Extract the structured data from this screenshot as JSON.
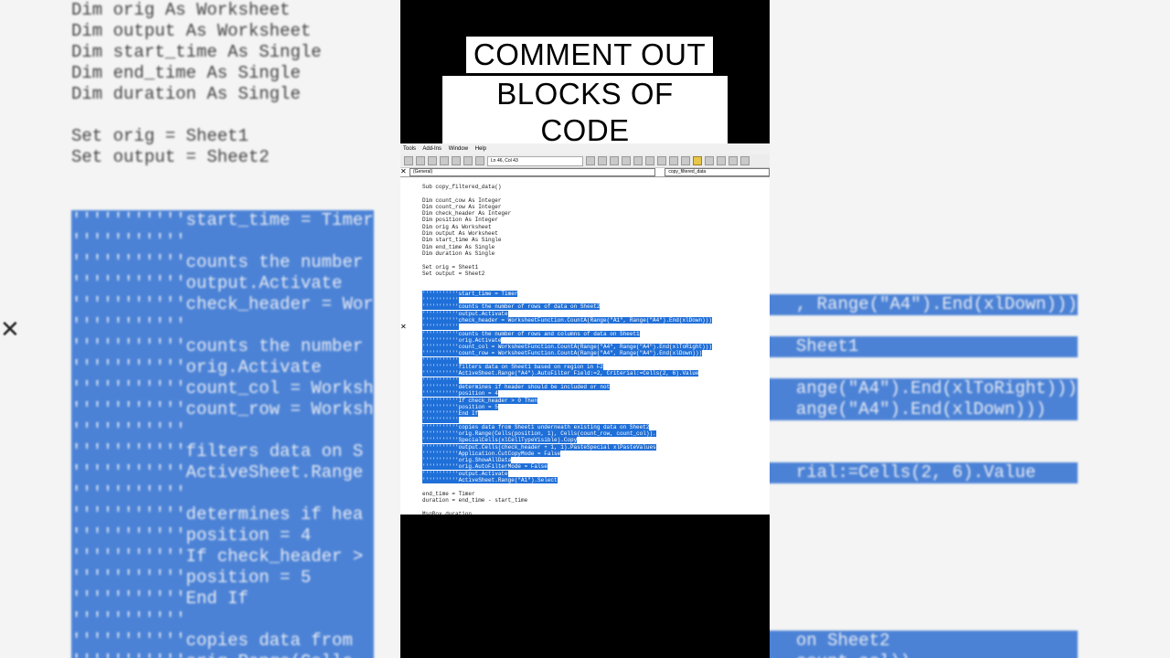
{
  "title": {
    "line1": "COMMENT OUT",
    "line2": "BLOCKS OF CODE"
  },
  "editor": {
    "menu": [
      "Tools",
      "Add-Ins",
      "Window",
      "Help"
    ],
    "position": "Ln 46, Col 43",
    "object_combo": "(General)",
    "proc_combo": "copy_filtered_data",
    "code_lines": [
      {
        "text": "Sub copy_filtered_data()",
        "sel": false
      },
      {
        "text": "",
        "sel": false
      },
      {
        "text": "Dim count_cow As Integer",
        "sel": false
      },
      {
        "text": "Dim count_row As Integer",
        "sel": false
      },
      {
        "text": "Dim check_header As Integer",
        "sel": false
      },
      {
        "text": "Dim position As Integer",
        "sel": false
      },
      {
        "text": "Dim orig As Worksheet",
        "sel": false
      },
      {
        "text": "Dim output As Worksheet",
        "sel": false
      },
      {
        "text": "Dim start_time As Single",
        "sel": false
      },
      {
        "text": "Dim end_time As Single",
        "sel": false
      },
      {
        "text": "Dim duration As Single",
        "sel": false
      },
      {
        "text": "",
        "sel": false
      },
      {
        "text": "Set orig = Sheet1",
        "sel": false
      },
      {
        "text": "Set output = Sheet2",
        "sel": false
      },
      {
        "text": "",
        "sel": false
      },
      {
        "text": "",
        "sel": false
      },
      {
        "text": "'''''''''''start_time = Timer",
        "sel": true
      },
      {
        "text": "'''''''''''",
        "sel": true
      },
      {
        "text": "'''''''''''counts the number of rows of data on Sheet2",
        "sel": true
      },
      {
        "text": "'''''''''''output.Activate",
        "sel": true
      },
      {
        "text": "'''''''''''check_header = WorksheetFunction.CountA(Range(\"A1\", Range(\"A4\").End(xlDown)))",
        "sel": true
      },
      {
        "text": "'''''''''''",
        "sel": true
      },
      {
        "text": "'''''''''''counts the number of rows and columns of data on Sheet1",
        "sel": true
      },
      {
        "text": "'''''''''''orig.Activate",
        "sel": true
      },
      {
        "text": "'''''''''''count_col = WorksheetFunction.CountA(Range(\"A4\", Range(\"A4\").End(xlToRight)))",
        "sel": true
      },
      {
        "text": "'''''''''''count_row = WorksheetFunction.CountA(Range(\"A4\", Range(\"A4\").End(xlDown)))",
        "sel": true
      },
      {
        "text": "'''''''''''",
        "sel": true
      },
      {
        "text": "'''''''''''filters data on Sheet1 based on region in F2",
        "sel": true
      },
      {
        "text": "'''''''''''ActiveSheet.Range(\"A4\").AutoFilter Field:=2, Criterial:=Cells(2, 6).Value",
        "sel": true
      },
      {
        "text": "'''''''''''",
        "sel": true
      },
      {
        "text": "'''''''''''determines if header should be included or not",
        "sel": true
      },
      {
        "text": "'''''''''''position = 4",
        "sel": true
      },
      {
        "text": "'''''''''''If check_header > 0 Then",
        "sel": true
      },
      {
        "text": "'''''''''''position = 5",
        "sel": true
      },
      {
        "text": "'''''''''''End If",
        "sel": true
      },
      {
        "text": "'''''''''''",
        "sel": true
      },
      {
        "text": "'''''''''''copies data from Sheet1 underneath existing data on Sheet2",
        "sel": true
      },
      {
        "text": "'''''''''''orig.Range(Cells(position, 1), Cells(count_row, count_col)).",
        "sel": true
      },
      {
        "text": "'''''''''''SpecialCells(xlCellTypeVisible).Copy",
        "sel": true
      },
      {
        "text": "'''''''''''output.Cells(check_header + 1, 1).PasteSpecial xlPasteValues",
        "sel": true
      },
      {
        "text": "'''''''''''Application.CutCopyMode = False",
        "sel": true
      },
      {
        "text": "'''''''''''orig.ShowAllData",
        "sel": true
      },
      {
        "text": "'''''''''''orig.AutoFilterMode = False",
        "sel": true
      },
      {
        "text": "'''''''''''output.Activate",
        "sel": true
      },
      {
        "text": "'''''''''''ActiveSheet.Range(\"A1\").Select",
        "sel": true
      },
      {
        "text": "",
        "sel": false
      },
      {
        "text": "end_time = Timer",
        "sel": false
      },
      {
        "text": "duration = end_time - start_time",
        "sel": false
      },
      {
        "text": "",
        "sel": false
      },
      {
        "text": "MsgBox duration",
        "sel": false
      }
    ]
  },
  "background": {
    "left_lines": [
      {
        "text": "Dim orig As Worksheet",
        "sel": false
      },
      {
        "text": "Dim output As Worksheet",
        "sel": false
      },
      {
        "text": "Dim start_time As Single",
        "sel": false
      },
      {
        "text": "Dim end_time As Single",
        "sel": false
      },
      {
        "text": "Dim duration As Single",
        "sel": false
      },
      {
        "text": "",
        "sel": false
      },
      {
        "text": "Set orig = Sheet1",
        "sel": false
      },
      {
        "text": "Set output = Sheet2",
        "sel": false
      },
      {
        "text": "",
        "sel": false
      },
      {
        "text": "",
        "sel": false
      },
      {
        "text": "'''''''''''start_time = Timer",
        "sel": true
      },
      {
        "text": "'''''''''''",
        "sel": true
      },
      {
        "text": "'''''''''''counts the number",
        "sel": true
      },
      {
        "text": "'''''''''''output.Activate",
        "sel": true
      },
      {
        "text": "'''''''''''check_header = Wor",
        "sel": true
      },
      {
        "text": "'''''''''''",
        "sel": true
      },
      {
        "text": "'''''''''''counts the number",
        "sel": true
      },
      {
        "text": "'''''''''''orig.Activate",
        "sel": true
      },
      {
        "text": "'''''''''''count_col = Worksh",
        "sel": true
      },
      {
        "text": "'''''''''''count_row = Worksh",
        "sel": true
      },
      {
        "text": "'''''''''''",
        "sel": true
      },
      {
        "text": "'''''''''''filters data on S",
        "sel": true
      },
      {
        "text": "'''''''''''ActiveSheet.Range",
        "sel": true
      },
      {
        "text": "'''''''''''",
        "sel": true
      },
      {
        "text": "'''''''''''determines if hea",
        "sel": true
      },
      {
        "text": "'''''''''''position = 4",
        "sel": true
      },
      {
        "text": "'''''''''''If check_header >",
        "sel": true
      },
      {
        "text": "'''''''''''position = 5",
        "sel": true
      },
      {
        "text": "'''''''''''End If",
        "sel": true
      },
      {
        "text": "'''''''''''",
        "sel": true
      },
      {
        "text": "'''''''''''copies data from",
        "sel": true
      },
      {
        "text": "'''''''''''orig.Range(Cells",
        "sel": true
      }
    ],
    "right_lines": [
      {
        "text": "",
        "sel": false
      },
      {
        "text": "",
        "sel": false
      },
      {
        "text": "",
        "sel": false
      },
      {
        "text": "",
        "sel": false
      },
      {
        "text": "",
        "sel": false
      },
      {
        "text": "",
        "sel": false
      },
      {
        "text": "",
        "sel": false
      },
      {
        "text": "",
        "sel": false
      },
      {
        "text": "",
        "sel": false
      },
      {
        "text": "",
        "sel": false
      },
      {
        "text": "",
        "sel": false
      },
      {
        "text": "",
        "sel": false
      },
      {
        "text": "",
        "sel": false
      },
      {
        "text": "",
        "sel": false
      },
      {
        "text": "                                          , Range(\"A4\").End(xlDown)))",
        "sel": true
      },
      {
        "text": "",
        "sel": false
      },
      {
        "text": "                                          Sheet1",
        "sel": true
      },
      {
        "text": "",
        "sel": false
      },
      {
        "text": "                                          ange(\"A4\").End(xlToRight)))",
        "sel": true
      },
      {
        "text": "                                          ange(\"A4\").End(xlDown)))",
        "sel": true
      },
      {
        "text": "",
        "sel": false
      },
      {
        "text": "",
        "sel": false
      },
      {
        "text": "                                          rial:=Cells(2, 6).Value",
        "sel": true
      },
      {
        "text": "",
        "sel": false
      },
      {
        "text": "",
        "sel": false
      },
      {
        "text": "",
        "sel": false
      },
      {
        "text": "",
        "sel": false
      },
      {
        "text": "",
        "sel": false
      },
      {
        "text": "",
        "sel": false
      },
      {
        "text": "",
        "sel": false
      },
      {
        "text": "                                          on Sheet2",
        "sel": true
      },
      {
        "text": "                                          count_col)).",
        "sel": true
      }
    ]
  }
}
